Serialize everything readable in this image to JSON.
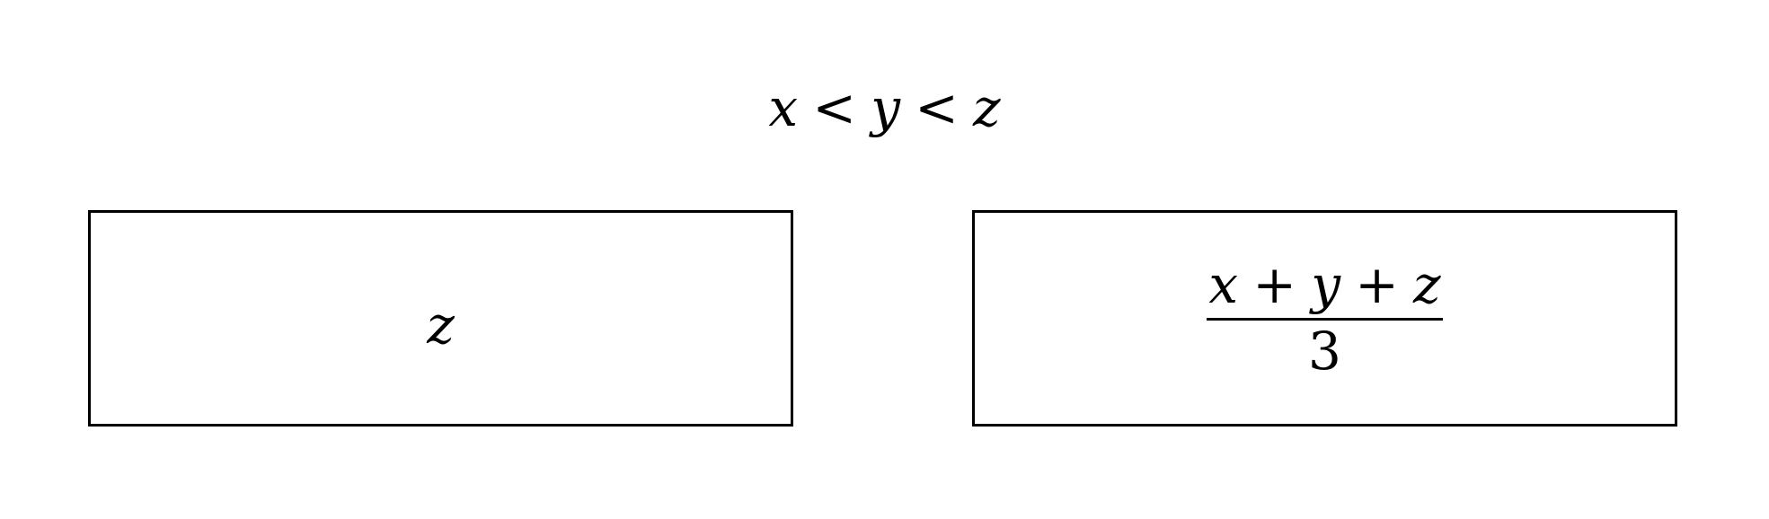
{
  "condition": {
    "var1": "x",
    "rel1": "<",
    "var2": "y",
    "rel2": "<",
    "var3": "z"
  },
  "box_a": {
    "expression": "z"
  },
  "box_b": {
    "numerator": {
      "term1": "x",
      "op1": "+",
      "term2": "y",
      "op2": "+",
      "term3": "z"
    },
    "denominator": "3"
  }
}
